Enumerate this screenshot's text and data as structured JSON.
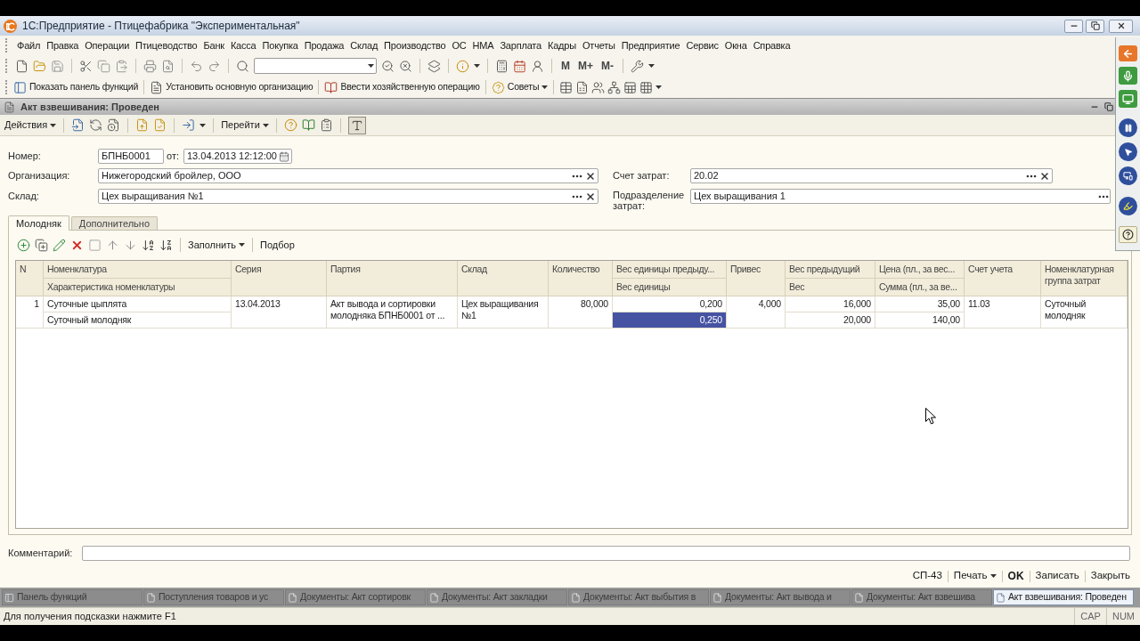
{
  "window": {
    "title": "1С:Предприятие - Птицефабрика \"Экспериментальная\""
  },
  "menu": [
    "Файл",
    "Правка",
    "Операции",
    "Птицеводство",
    "Банк",
    "Касса",
    "Покупка",
    "Продажа",
    "Склад",
    "Производство",
    "ОС",
    "НМА",
    "Зарплата",
    "Кадры",
    "Отчеты",
    "Предприятие",
    "Сервис",
    "Окна",
    "Справка"
  ],
  "toolbar": {
    "memory_commands": [
      "M",
      "M+",
      "M-"
    ]
  },
  "panel_toolbar": [
    {
      "label": "Показать панель функций",
      "kind": "button"
    },
    {
      "label": "Установить основную организацию",
      "kind": "button"
    },
    {
      "label": "Ввести хозяйственную операцию",
      "kind": "button"
    },
    {
      "label": "Советы",
      "kind": "menu"
    }
  ],
  "document": {
    "title": "Акт взвешивания: Проведен",
    "toolbar": {
      "actions": "Действия",
      "goto": "Перейти",
      "filter_pressed": true
    },
    "fields": {
      "number": {
        "label": "Номер:",
        "value": "БПНБ0001"
      },
      "date": {
        "label": "от:",
        "value": "13.04.2013 12:12:00"
      },
      "organization": {
        "label": "Организация:",
        "value": "Нижегородский бройлер, ООО"
      },
      "warehouse": {
        "label": "Склад:",
        "value": "Цех выращивания №1"
      },
      "cost_account": {
        "label": "Счет затрат:",
        "value": "20.02"
      },
      "cost_division": {
        "label": "Подразделение затрат:",
        "value": "Цех выращивания 1"
      }
    },
    "tabs": [
      {
        "label": "Молодняк",
        "selected": true
      },
      {
        "label": "Дополнительно",
        "selected": false
      }
    ],
    "tab_toolbar": {
      "fill": "Заполнить",
      "pick": "Подбор"
    },
    "table": {
      "columns": [
        {
          "title": "N",
          "kind": "number"
        },
        {
          "title": "Номенклатура",
          "subtitle": "Характеристика номенклатуры",
          "kind": "text"
        },
        {
          "title": "Серия",
          "kind": "text"
        },
        {
          "title": "Партия",
          "kind": "text"
        },
        {
          "title": "Склад",
          "kind": "text"
        },
        {
          "title": "Количество",
          "kind": "number"
        },
        {
          "title": "Вес единицы предыду...",
          "subtitle": "Вес единицы",
          "kind": "number"
        },
        {
          "title": "Привес",
          "kind": "number"
        },
        {
          "title": "Вес предыдущий",
          "subtitle": "Вес",
          "kind": "number"
        },
        {
          "title": "Цена (пл., за вес...",
          "subtitle": "Сумма (пл., за ве...",
          "kind": "number"
        },
        {
          "title": "Счет учета",
          "kind": "text"
        },
        {
          "title": "Номенклатурная группа затрат",
          "kind": "text"
        }
      ],
      "rows": [
        {
          "cells": [
            {
              "text": "1",
              "selected": false
            },
            {
              "text": "Суточные цыплята",
              "selected": false,
              "sub": {
                "text": "Суточный молодняк",
                "selected": false
              }
            },
            {
              "text": "13.04.2013",
              "selected": false
            },
            {
              "text": "Акт вывода и сортировки молодняка БПНБ0001 от ...",
              "selected": false
            },
            {
              "text": "Цех выращивания №1",
              "selected": false
            },
            {
              "text": "80,000",
              "selected": false
            },
            {
              "text": "0,200",
              "selected": false,
              "sub": {
                "text": "0,250",
                "selected": true
              }
            },
            {
              "text": "4,000",
              "selected": false
            },
            {
              "text": "16,000",
              "selected": false,
              "sub": {
                "text": "20,000",
                "selected": false
              }
            },
            {
              "text": "35,00",
              "selected": false,
              "sub": {
                "text": "140,00",
                "selected": false
              }
            },
            {
              "text": "11.03",
              "selected": false
            },
            {
              "text": "Суточный молодняк",
              "selected": false
            }
          ]
        }
      ]
    },
    "comment": {
      "label": "Комментарий:"
    },
    "footer_commands": [
      {
        "label": "СП-43",
        "kind": "button"
      },
      {
        "label": "Печать",
        "kind": "menu"
      },
      {
        "label": "OK",
        "kind": "default"
      },
      {
        "label": "Записать",
        "kind": "button"
      },
      {
        "label": "Закрыть",
        "kind": "button"
      }
    ]
  },
  "window_tabs": [
    {
      "label": "Панель функций",
      "selected": false
    },
    {
      "label": "Поступления товаров и ус",
      "selected": false
    },
    {
      "label": "Документы: Акт сортировк",
      "selected": false
    },
    {
      "label": "Документы: Акт закладки",
      "selected": false
    },
    {
      "label": "Документы: Акт выбытия в",
      "selected": false
    },
    {
      "label": "Документы: Акт вывода и",
      "selected": false
    },
    {
      "label": "Документы: Акт взвешива",
      "selected": false
    },
    {
      "label": "Акт взвешивания: Проведен",
      "selected": true
    }
  ],
  "status_bar": {
    "hint": "Для получения подсказки нажмите F1",
    "indicators": [
      "CAP",
      "NUM"
    ]
  }
}
